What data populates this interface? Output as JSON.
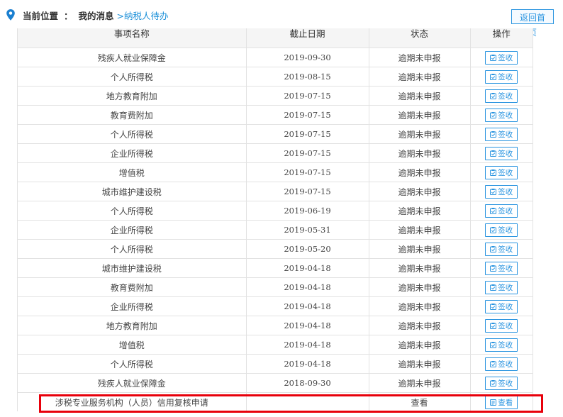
{
  "breadcrumb": {
    "label": "当前位置",
    "colon": "：",
    "current": "我的消息",
    "link": ">纳税人待办"
  },
  "home_button": "返回首页",
  "columns": [
    "事项名称",
    "截止日期",
    "状态",
    "操作"
  ],
  "rows": [
    {
      "name": "残疾人就业保障金",
      "date": "2019-09-30",
      "status": "逾期未申报",
      "action": "签收"
    },
    {
      "name": "个人所得税",
      "date": "2019-08-15",
      "status": "逾期未申报",
      "action": "签收"
    },
    {
      "name": "地方教育附加",
      "date": "2019-07-15",
      "status": "逾期未申报",
      "action": "签收"
    },
    {
      "name": "教育费附加",
      "date": "2019-07-15",
      "status": "逾期未申报",
      "action": "签收"
    },
    {
      "name": "个人所得税",
      "date": "2019-07-15",
      "status": "逾期未申报",
      "action": "签收"
    },
    {
      "name": "企业所得税",
      "date": "2019-07-15",
      "status": "逾期未申报",
      "action": "签收"
    },
    {
      "name": "增值税",
      "date": "2019-07-15",
      "status": "逾期未申报",
      "action": "签收"
    },
    {
      "name": "城市维护建设税",
      "date": "2019-07-15",
      "status": "逾期未申报",
      "action": "签收"
    },
    {
      "name": "个人所得税",
      "date": "2019-06-19",
      "status": "逾期未申报",
      "action": "签收"
    },
    {
      "name": "企业所得税",
      "date": "2019-05-31",
      "status": "逾期未申报",
      "action": "签收"
    },
    {
      "name": "个人所得税",
      "date": "2019-05-20",
      "status": "逾期未申报",
      "action": "签收"
    },
    {
      "name": "城市维护建设税",
      "date": "2019-04-18",
      "status": "逾期未申报",
      "action": "签收"
    },
    {
      "name": "教育费附加",
      "date": "2019-04-18",
      "status": "逾期未申报",
      "action": "签收"
    },
    {
      "name": "企业所得税",
      "date": "2019-04-18",
      "status": "逾期未申报",
      "action": "签收"
    },
    {
      "name": "地方教育附加",
      "date": "2019-04-18",
      "status": "逾期未申报",
      "action": "签收"
    },
    {
      "name": "增值税",
      "date": "2019-04-18",
      "status": "逾期未申报",
      "action": "签收"
    },
    {
      "name": "个人所得税",
      "date": "2019-04-18",
      "status": "逾期未申报",
      "action": "签收"
    },
    {
      "name": "残疾人就业保障金",
      "date": "2018-09-30",
      "status": "逾期未申报",
      "action": "签收"
    },
    {
      "name": "涉税专业服务机构（人员）信用复核申请",
      "date": "",
      "status": "查看",
      "action": "查看"
    }
  ],
  "colors": {
    "accent": "#2b95e0",
    "highlight": "#e8000b"
  }
}
